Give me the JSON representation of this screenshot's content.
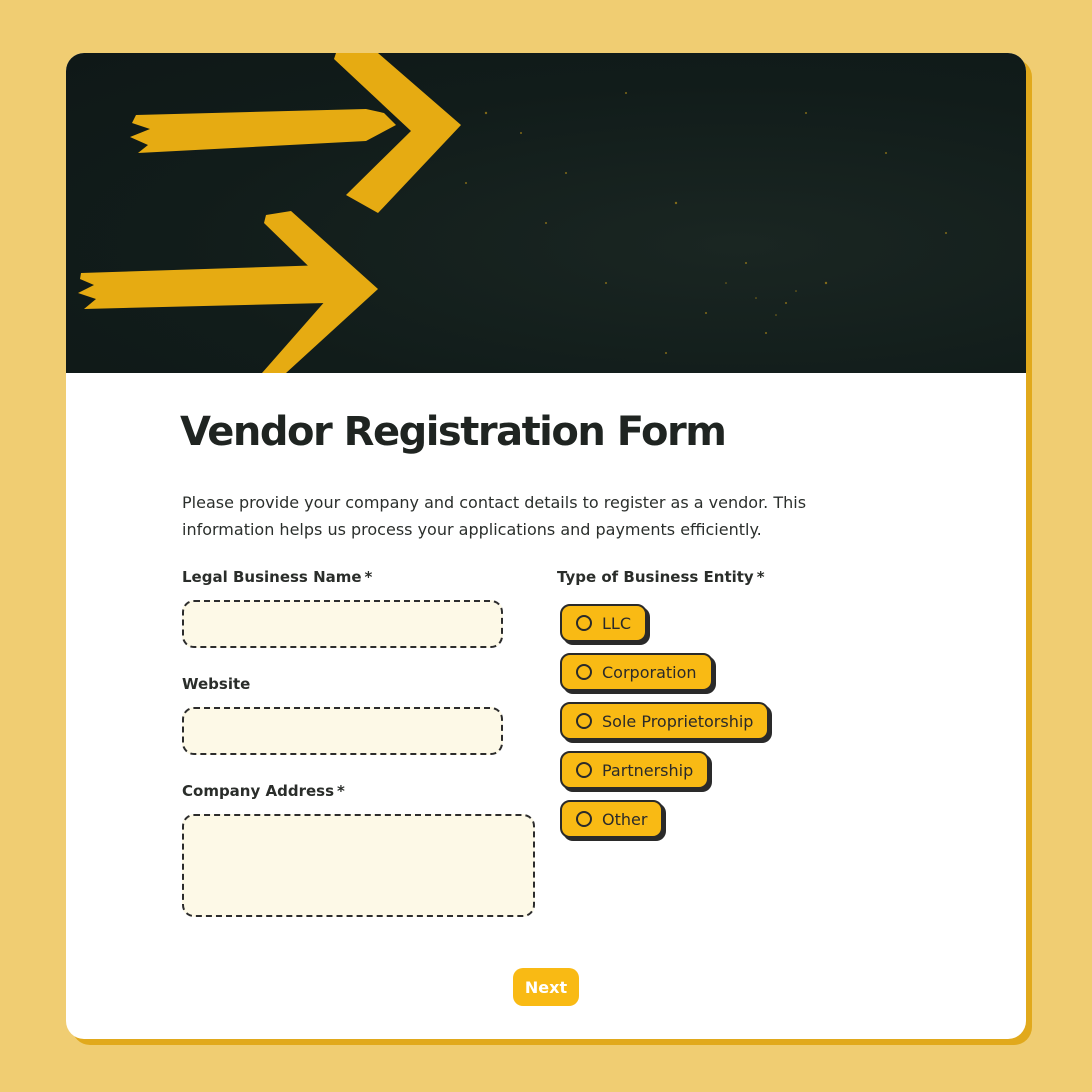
{
  "colors": {
    "page_background": "#f0cd72",
    "card_background": "#ffffff",
    "card_shadow": "#e1a91c",
    "hero_background": "#111c1a",
    "arrow_color": "#e6ab12",
    "accent": "#f9ba14",
    "field_background": "#fdf9e7",
    "text": "#222222"
  },
  "hero": {
    "icon": "arrows-illustration"
  },
  "form": {
    "title": "Vendor Registration Form",
    "description": "Please provide your company and contact details to register as a vendor. This information helps us process your applications and payments efficiently.",
    "fields": {
      "legal_name": {
        "label": "Legal Business Name",
        "required_mark": "*",
        "value": ""
      },
      "website": {
        "label": "Website",
        "value": ""
      },
      "address": {
        "label": "Company Address",
        "required_mark": "*",
        "value": ""
      }
    },
    "entity": {
      "label": "Type of Business Entity",
      "required_mark": "*",
      "options": [
        "LLC",
        "Corporation",
        "Sole Proprietorship",
        "Partnership",
        "Other"
      ],
      "selected": null
    },
    "next_label": "Next"
  }
}
